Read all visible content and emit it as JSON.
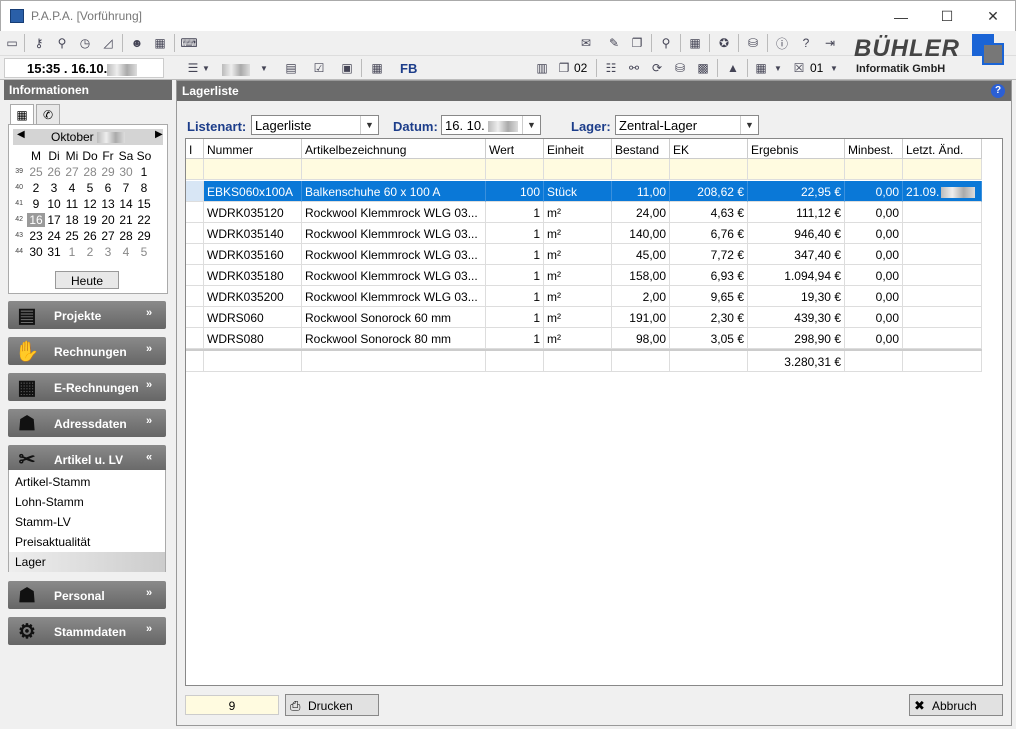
{
  "window": {
    "title": "P.A.P.A. [Vorführung]",
    "controls": {
      "minimize": "—",
      "maximize": "☐",
      "close": "✕"
    }
  },
  "toolbar": {
    "time": "15:35 . 16.10.",
    "fb_label": "FB",
    "counter_a": "02",
    "counter_b": "01"
  },
  "brand": {
    "name": "BÜHLER",
    "subtitle": "Informatik GmbH"
  },
  "sidebar": {
    "title": "Informationen",
    "calendar": {
      "month": "Oktober",
      "weekdays": [
        "M",
        "Di",
        "Mi",
        "Do",
        "Fr",
        "Sa",
        "So"
      ],
      "weeks": [
        {
          "wk": "39",
          "days": [
            "25",
            "26",
            "27",
            "28",
            "29",
            "30",
            "1"
          ]
        },
        {
          "wk": "40",
          "days": [
            "2",
            "3",
            "4",
            "5",
            "6",
            "7",
            "8"
          ]
        },
        {
          "wk": "41",
          "days": [
            "9",
            "10",
            "11",
            "12",
            "13",
            "14",
            "15"
          ]
        },
        {
          "wk": "42",
          "days": [
            "16",
            "17",
            "18",
            "19",
            "20",
            "21",
            "22"
          ]
        },
        {
          "wk": "43",
          "days": [
            "23",
            "24",
            "25",
            "26",
            "27",
            "28",
            "29"
          ]
        },
        {
          "wk": "44",
          "days": [
            "30",
            "31",
            "1",
            "2",
            "3",
            "4",
            "5"
          ]
        }
      ],
      "today_button": "Heute"
    },
    "nav": [
      {
        "label": "Projekte"
      },
      {
        "label": "Rechnungen"
      },
      {
        "label": "E-Rechnungen"
      },
      {
        "label": "Adressdaten"
      },
      {
        "label": "Artikel u. LV"
      },
      {
        "label": "Personal"
      },
      {
        "label": "Stammdaten"
      }
    ],
    "submenu": [
      "Artikel-Stamm",
      "Lohn-Stamm",
      "Stamm-LV",
      "Preisaktualität",
      "Lager"
    ]
  },
  "main": {
    "title": "Lagerliste",
    "help": "?",
    "filters": {
      "listenart_label": "Listenart:",
      "listenart_value": "Lagerliste",
      "datum_label": "Datum:",
      "datum_value": "16. 10.",
      "lager_label": "Lager:",
      "lager_value": "Zentral-Lager"
    },
    "columns": [
      "I",
      "Nummer",
      "Artikelbezeichnung",
      "Wert",
      "Einheit",
      "Bestand",
      "EK",
      "Ergebnis",
      "Minbest.",
      "Letzt. Änd."
    ],
    "rows": [
      [
        "",
        "EBKS060x100A",
        "Balkenschuhe 60 x 100 A",
        "100",
        "Stück",
        "11,00",
        "208,62 €",
        "22,95 €",
        "0,00",
        "21.09."
      ],
      [
        "",
        "WDRK035120",
        "Rockwool Klemmrock WLG 03...",
        "1",
        "m²",
        "24,00",
        "4,63 €",
        "111,12 €",
        "0,00",
        ""
      ],
      [
        "",
        "WDRK035140",
        "Rockwool Klemmrock WLG 03...",
        "1",
        "m²",
        "140,00",
        "6,76 €",
        "946,40 €",
        "0,00",
        ""
      ],
      [
        "",
        "WDRK035160",
        "Rockwool Klemmrock WLG 03...",
        "1",
        "m²",
        "45,00",
        "7,72 €",
        "347,40 €",
        "0,00",
        ""
      ],
      [
        "",
        "WDRK035180",
        "Rockwool Klemmrock WLG 03...",
        "1",
        "m²",
        "158,00",
        "6,93 €",
        "1.094,94 €",
        "0,00",
        ""
      ],
      [
        "",
        "WDRK035200",
        "Rockwool Klemmrock WLG 03...",
        "1",
        "m²",
        "2,00",
        "9,65 €",
        "19,30 €",
        "0,00",
        ""
      ],
      [
        "",
        "WDRS060",
        "Rockwool Sonorock 60 mm",
        "1",
        "m²",
        "191,00",
        "2,30 €",
        "439,30 €",
        "0,00",
        ""
      ],
      [
        "",
        "WDRS080",
        "Rockwool Sonorock 80 mm",
        "1",
        "m²",
        "98,00",
        "3,05 €",
        "298,90 €",
        "0,00",
        ""
      ]
    ],
    "total": "3.280,31 €",
    "count": "9",
    "print_button": "Drucken",
    "cancel_button": "Abbruch"
  }
}
